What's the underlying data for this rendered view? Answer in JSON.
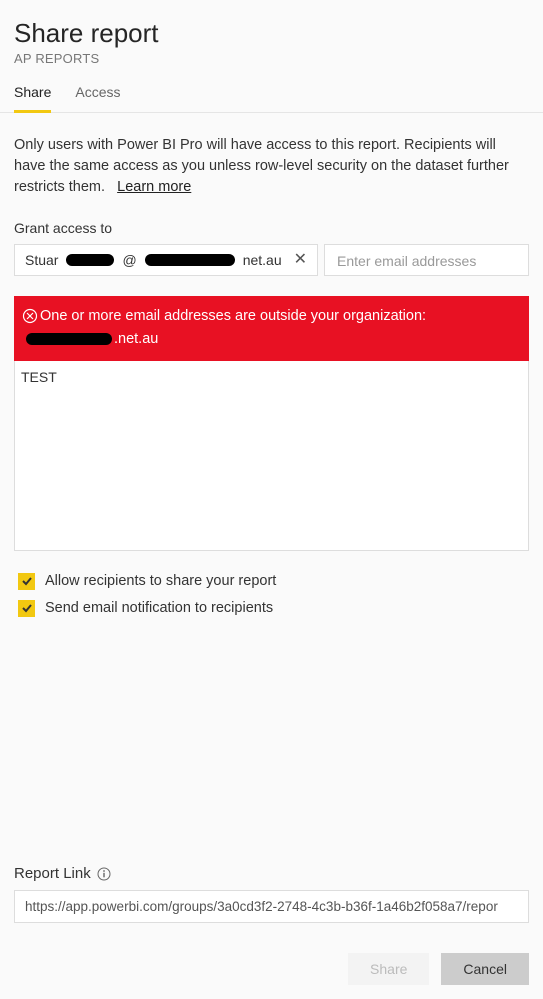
{
  "header": {
    "title": "Share report",
    "subtitle": "AP REPORTS"
  },
  "tabs": {
    "share": "Share",
    "access": "Access"
  },
  "description": "Only users with Power BI Pro will have access to this report. Recipients will have the same access as you unless row-level security on the dataset further restricts them.",
  "learn_more": "Learn more",
  "grant_label": "Grant access to",
  "chip": {
    "prefix": "Stuar",
    "at": "@",
    "suffix": "net.au"
  },
  "email_placeholder": "Enter email addresses",
  "warning": {
    "line1": "One or more email addresses are outside your organization:",
    "line2_suffix": ".net.au"
  },
  "message": "TEST",
  "checks": {
    "allow_share": "Allow recipients to share your report",
    "send_email": "Send email notification to recipients"
  },
  "report_link_label": "Report Link",
  "report_link": "https://app.powerbi.com/groups/3a0cd3f2-2748-4c3b-b36f-1a46b2f058a7/repor",
  "buttons": {
    "share": "Share",
    "cancel": "Cancel"
  }
}
